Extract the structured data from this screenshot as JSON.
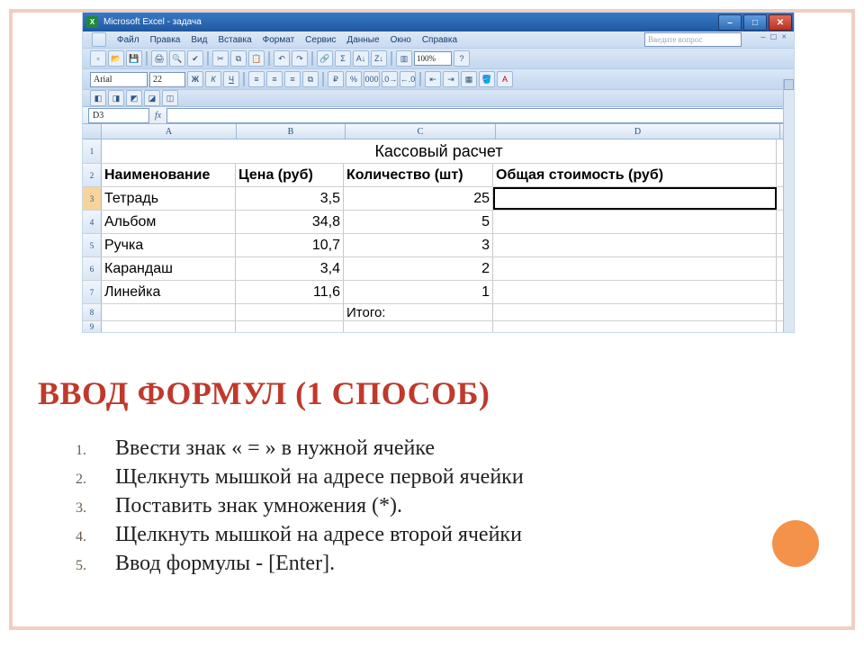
{
  "excel": {
    "title": "Microsoft Excel - задача",
    "menu": [
      "Файл",
      "Правка",
      "Вид",
      "Вставка",
      "Формат",
      "Сервис",
      "Данные",
      "Окно",
      "Справка"
    ],
    "ask_placeholder": "Введите вопрос",
    "font_name": "Arial",
    "font_size": "22",
    "zoom": "100%",
    "namebox": "D3",
    "cols": [
      "A",
      "B",
      "C",
      "D"
    ],
    "sheet_title": "Кассовый расчет",
    "headers": {
      "a": "Наименование",
      "b": "Цена (руб)",
      "c": "Количество (шт)",
      "d": "Общая стоимость (руб)"
    },
    "rows": [
      {
        "a": "Тетрадь",
        "b": "3,5",
        "c": "25",
        "d": ""
      },
      {
        "a": "Альбом",
        "b": "34,8",
        "c": "5",
        "d": ""
      },
      {
        "a": "Ручка",
        "b": "10,7",
        "c": "3",
        "d": ""
      },
      {
        "a": "Карандаш",
        "b": "3,4",
        "c": "2",
        "d": ""
      },
      {
        "a": "Линейка",
        "b": "11,6",
        "c": "1",
        "d": ""
      }
    ],
    "total_label": "Итого:"
  },
  "slide": {
    "heading": "ВВОД ФОРМУЛ (1 СПОСОБ)",
    "items": [
      "Ввести знак « = » в нужной ячейке",
      "Щелкнуть мышкой на адресе первой ячейки",
      "Поставить знак умножения (*).",
      "Щелкнуть мышкой на адресе второй ячейки",
      "Ввод формулы - [Enter]."
    ]
  }
}
